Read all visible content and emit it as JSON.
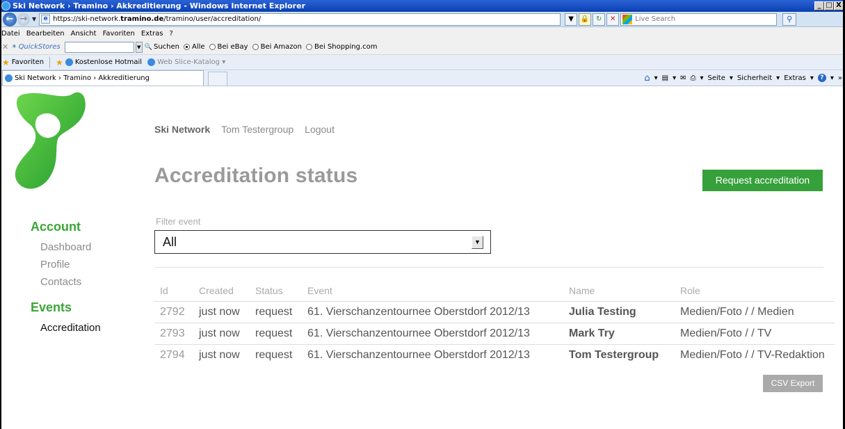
{
  "window": {
    "title": "Ski Network › Tramino › Akkreditierung - Windows Internet Explorer",
    "controls": [
      "_",
      "□",
      "X"
    ]
  },
  "address": {
    "url_prefix": "https://ski-network.",
    "url_host": "tramino.de",
    "url_path": "/tramino/user/accreditation/",
    "search_placeholder": "Live Search"
  },
  "menu": [
    "Datei",
    "Bearbeiten",
    "Ansicht",
    "Favoriten",
    "Extras",
    "?"
  ],
  "quickstores": {
    "label": "QuickStores",
    "search_label": "Suchen",
    "options": [
      "Alle",
      "Bei eBay",
      "Bei Amazon",
      "Bei Shopping.com"
    ],
    "selected": "Alle"
  },
  "favorites": {
    "label": "Favoriten",
    "items": [
      "Kostenlose Hotmail",
      "Web Slice-Katalog"
    ]
  },
  "tab": {
    "label": "Ski Network › Tramino › Akkreditierung"
  },
  "command_bar": [
    "Seite",
    "Sicherheit",
    "Extras"
  ],
  "page": {
    "nav": {
      "brand": "Ski Network",
      "user": "Tom Testergroup",
      "logout": "Logout"
    },
    "title": "Accreditation status",
    "request_button": "Request accreditation",
    "sidebar": {
      "account_heading": "Account",
      "account_items": [
        "Dashboard",
        "Profile",
        "Contacts"
      ],
      "events_heading": "Events",
      "events_items": [
        "Accreditation"
      ]
    },
    "filter": {
      "label": "Filter event",
      "value": "All"
    },
    "table": {
      "headers": [
        "Id",
        "Created",
        "Status",
        "Event",
        "Name",
        "Role"
      ],
      "rows": [
        {
          "id": "2792",
          "created": "just now",
          "status": "request",
          "event": "61. Vierschanzentournee Oberstdorf 2012/13",
          "name": "Julia Testing",
          "role": "Medien/Foto / / Medien"
        },
        {
          "id": "2793",
          "created": "just now",
          "status": "request",
          "event": "61. Vierschanzentournee Oberstdorf 2012/13",
          "name": "Mark Try",
          "role": "Medien/Foto / / TV"
        },
        {
          "id": "2794",
          "created": "just now",
          "status": "request",
          "event": "61. Vierschanzentournee Oberstdorf 2012/13",
          "name": "Tom Testergroup",
          "role": "Medien/Foto / / TV-Redaktion"
        }
      ]
    },
    "csv_button": "CSV Export"
  },
  "colors": {
    "brand_green": "#36a03a",
    "heading_gray": "#9a9a9a",
    "ie_titlebar": "#0a3fb0"
  }
}
